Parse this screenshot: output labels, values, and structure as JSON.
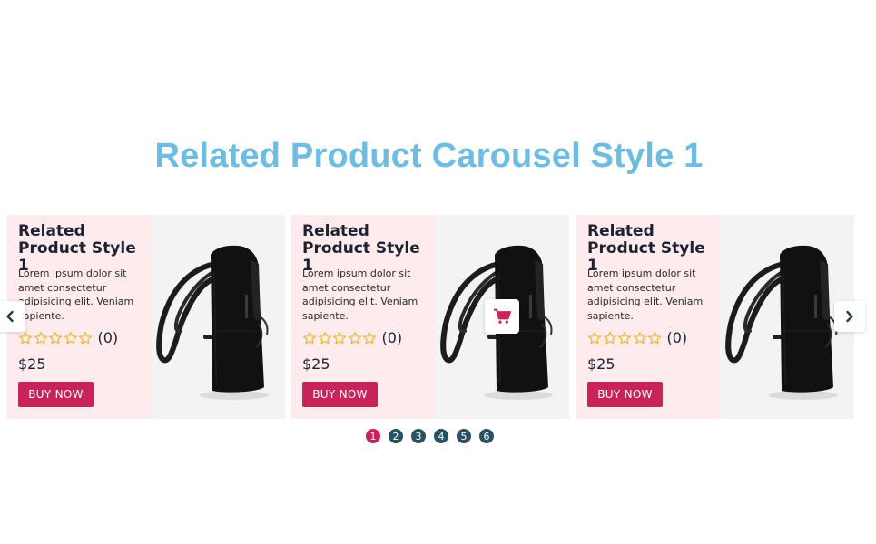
{
  "heading": "Related Product Carousel Style 1",
  "products": [
    {
      "title": "Related Product Style 1",
      "description": "Lorem ipsum dolor sit amet consectetur adipisicing elit. Veniam sapiente.",
      "rating_count": "(0)",
      "rating_value": 0,
      "price": "$25",
      "button_label": "BUY NOW",
      "image_icon": "backpack-image"
    },
    {
      "title": "Related Product Style 1",
      "description": "Lorem ipsum dolor sit amet consectetur adipisicing elit. Veniam sapiente.",
      "rating_count": "(0)",
      "rating_value": 0,
      "price": "$25",
      "button_label": "BUY NOW",
      "image_icon": "backpack-image",
      "hover_action_icon": "cart-icon"
    },
    {
      "title": "Related Product Style 1",
      "description": "Lorem ipsum dolor sit amet consectetur adipisicing elit. Veniam sapiente.",
      "rating_count": "(0)",
      "rating_value": 0,
      "price": "$25",
      "button_label": "BUY NOW",
      "image_icon": "backpack-image"
    }
  ],
  "navigation": {
    "prev_icon": "chevron-left-icon",
    "next_icon": "chevron-right-icon"
  },
  "pagination": {
    "pages": [
      "1",
      "2",
      "3",
      "4",
      "5",
      "6"
    ],
    "active": "1"
  },
  "colors": {
    "heading": "#6dbde3",
    "card_info_bg": "#fdebed",
    "card_image_bg": "#f3f3f3",
    "accent": "#c8235b",
    "star": "#f2b531",
    "dot": "#285264"
  }
}
